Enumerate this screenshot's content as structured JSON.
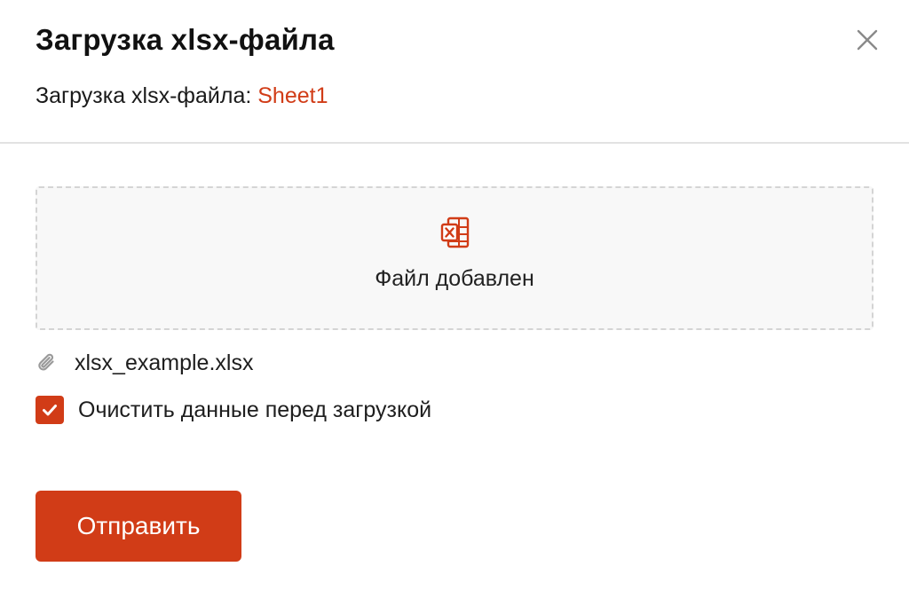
{
  "dialog": {
    "title": "Загрузка xlsx-файла",
    "subtitle_prefix": "Загрузка xlsx-файла: ",
    "sheet_name": "Sheet1",
    "close_icon": "close-icon"
  },
  "dropzone": {
    "icon": "excel-file-icon",
    "status_text": "Файл добавлен"
  },
  "attachment": {
    "icon": "paperclip-icon",
    "file_name": "xlsx_example.xlsx"
  },
  "options": {
    "clear_before_upload": {
      "label": "Очистить данные перед загрузкой",
      "checked": true
    }
  },
  "actions": {
    "submit_label": "Отправить"
  },
  "colors": {
    "accent": "#d13c17",
    "dropzone_bg": "#f8f8f8",
    "dropzone_border": "#d4d4d4",
    "divider": "#e2e2e2"
  }
}
